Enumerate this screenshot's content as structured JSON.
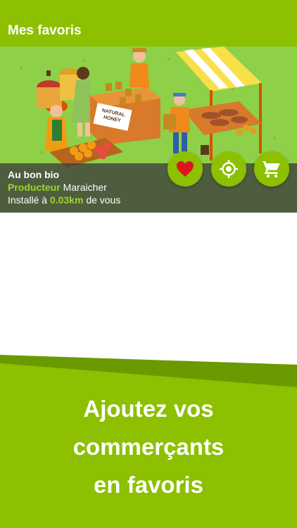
{
  "header": {
    "title": "Mes favoris"
  },
  "shop": {
    "name": "Au bon bio",
    "category_label": "Producteur",
    "category_value": "Maraicher",
    "distance_prefix": "Installé à",
    "distance_value": "0.03km",
    "distance_suffix": "de vous",
    "illustration_sign": "NATURAL HONEY"
  },
  "actions": {
    "favorite_icon": "heart-icon",
    "locate_icon": "target-icon",
    "shop_icon": "cart-icon"
  },
  "promo": {
    "lines": [
      "Ajoutez vos",
      "commerçants",
      "en favoris"
    ]
  },
  "colors": {
    "brand_green": "#8cc000",
    "dark_green": "#6a9a00",
    "accent_green": "#9fd52a",
    "heart_red": "#e0141c"
  }
}
